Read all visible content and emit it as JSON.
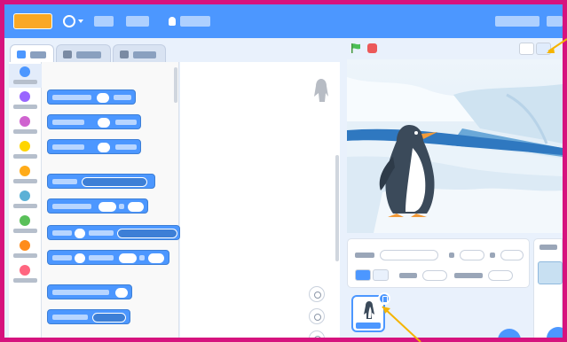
{
  "app": {
    "colors": {
      "frame_border": "#d6137e",
      "menubar": "#4c97ff",
      "motion_block": "#4c97ff",
      "motion_block_edge": "#3d7fd6",
      "stop": "#ec5959",
      "flag": "#4cbf56",
      "annotation": "#f5b400"
    }
  },
  "menubar": {
    "logo_icon": "scratch-logo-icon",
    "globe_icon": "globe-icon",
    "file_label": "",
    "edit_label": "",
    "tutorials_label": "",
    "project_title": "",
    "account_label": ""
  },
  "tabs": {
    "code_label": "",
    "costumes_label": "",
    "sounds_label": ""
  },
  "categories": [
    {
      "label": "",
      "color": "#4c97ff",
      "selected": true
    },
    {
      "label": "",
      "color": "#9966ff",
      "selected": false
    },
    {
      "label": "",
      "color": "#cf63cf",
      "selected": false
    },
    {
      "label": "",
      "color": "#ffd500",
      "selected": false
    },
    {
      "label": "",
      "color": "#ffab19",
      "selected": false
    },
    {
      "label": "",
      "color": "#5cb1d6",
      "selected": false
    },
    {
      "label": "",
      "color": "#59c059",
      "selected": false
    },
    {
      "label": "",
      "color": "#ff8c1a",
      "selected": false
    },
    {
      "label": "",
      "color": "#ff6680",
      "selected": false
    }
  ],
  "palette": {
    "heading": "",
    "blocks": [
      {
        "label": "",
        "input1": "",
        "label2": ""
      },
      {
        "label": "",
        "input1": "",
        "label2": ""
      },
      {
        "label": "",
        "input1": "",
        "label2": ""
      },
      {
        "label": "",
        "dropdown": ""
      },
      {
        "label": "",
        "input1": "",
        "label2": "",
        "input2": ""
      },
      {
        "label": "",
        "input1": "",
        "label2": "",
        "dropdown": ""
      },
      {
        "label": "",
        "input1": "",
        "label2": "",
        "input2": "",
        "label3": "",
        "input3": ""
      },
      {
        "label": "",
        "input1": ""
      },
      {
        "label": "",
        "dropdown": ""
      }
    ]
  },
  "stage": {
    "flag_icon": "green-flag-icon",
    "stop_icon": "stop-icon",
    "small_stage_icon": "small-stage-icon",
    "fullscreen_icon": "fullscreen-icon"
  },
  "sprite_info": {
    "sprite_label": "",
    "sprite_name": "",
    "x_label": "",
    "x_value": "",
    "y_label": "",
    "y_value": "",
    "show_label": "",
    "size_label": "",
    "size_value": "",
    "direction_label": "",
    "direction_value": ""
  },
  "sprites": [
    {
      "name": "",
      "selected": true
    }
  ],
  "backdrop": {
    "label": ""
  }
}
